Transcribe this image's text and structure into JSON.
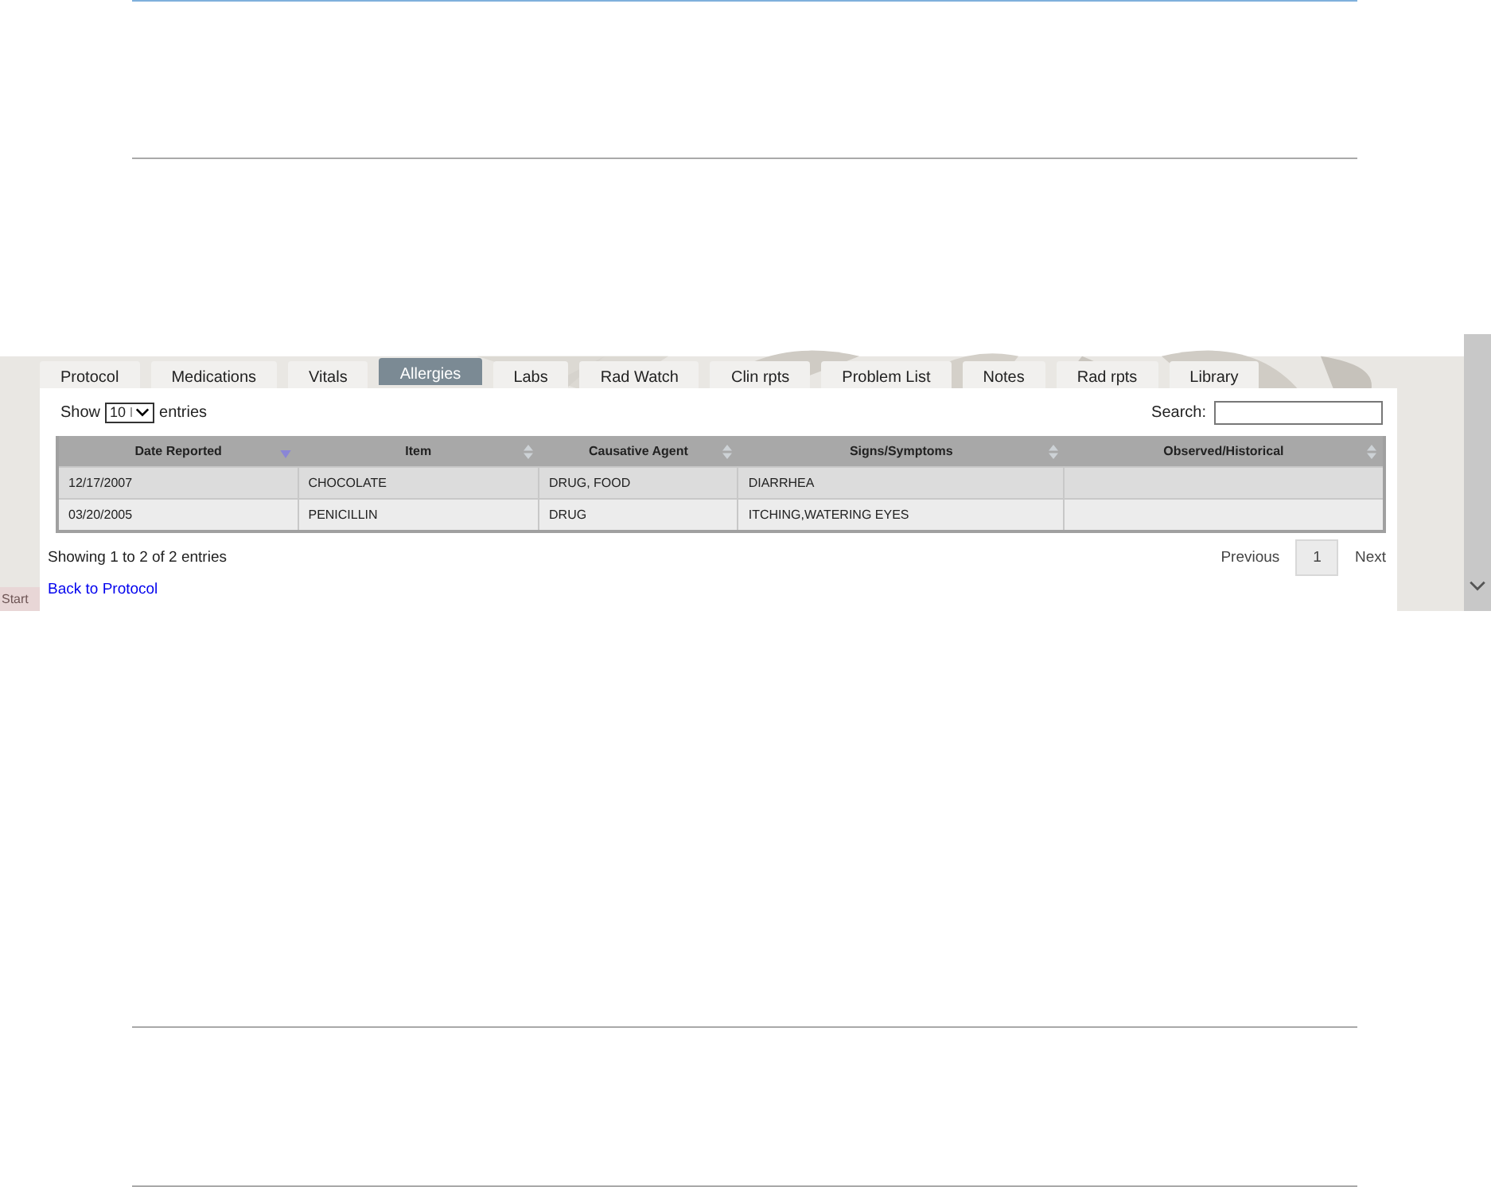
{
  "tabs": [
    {
      "label": "Protocol",
      "selected": false
    },
    {
      "label": "Medications",
      "selected": false
    },
    {
      "label": "Vitals",
      "selected": false
    },
    {
      "label": "Allergies",
      "selected": true
    },
    {
      "label": "Labs",
      "selected": false
    },
    {
      "label": "Rad Watch",
      "selected": false
    },
    {
      "label": "Clin rpts",
      "selected": false
    },
    {
      "label": "Problem List",
      "selected": false
    },
    {
      "label": "Notes",
      "selected": false
    },
    {
      "label": "Rad rpts",
      "selected": false
    },
    {
      "label": "Library",
      "selected": false
    }
  ],
  "length_menu": {
    "before": "Show",
    "value": "10",
    "after": "entries"
  },
  "search": {
    "label": "Search:"
  },
  "table": {
    "columns": [
      {
        "label": "Date Reported",
        "sorted": true
      },
      {
        "label": "Item",
        "sorted": false
      },
      {
        "label": "Causative Agent",
        "sorted": false
      },
      {
        "label": "Signs/Symptoms",
        "sorted": false
      },
      {
        "label": "Observed/Historical",
        "sorted": false
      }
    ],
    "rows": [
      [
        "12/17/2007",
        "CHOCOLATE",
        "DRUG, FOOD",
        "DIARRHEA",
        ""
      ],
      [
        "03/20/2005",
        "PENICILLIN",
        "DRUG",
        "ITCHING,WATERING EYES",
        ""
      ]
    ]
  },
  "info": "Showing 1 to 2 of 2 entries",
  "pagination": {
    "previous": "Previous",
    "pages": [
      {
        "label": "1",
        "selected": true
      }
    ],
    "next": "Next"
  },
  "back_link": "Back to Protocol",
  "start_button": "Start"
}
